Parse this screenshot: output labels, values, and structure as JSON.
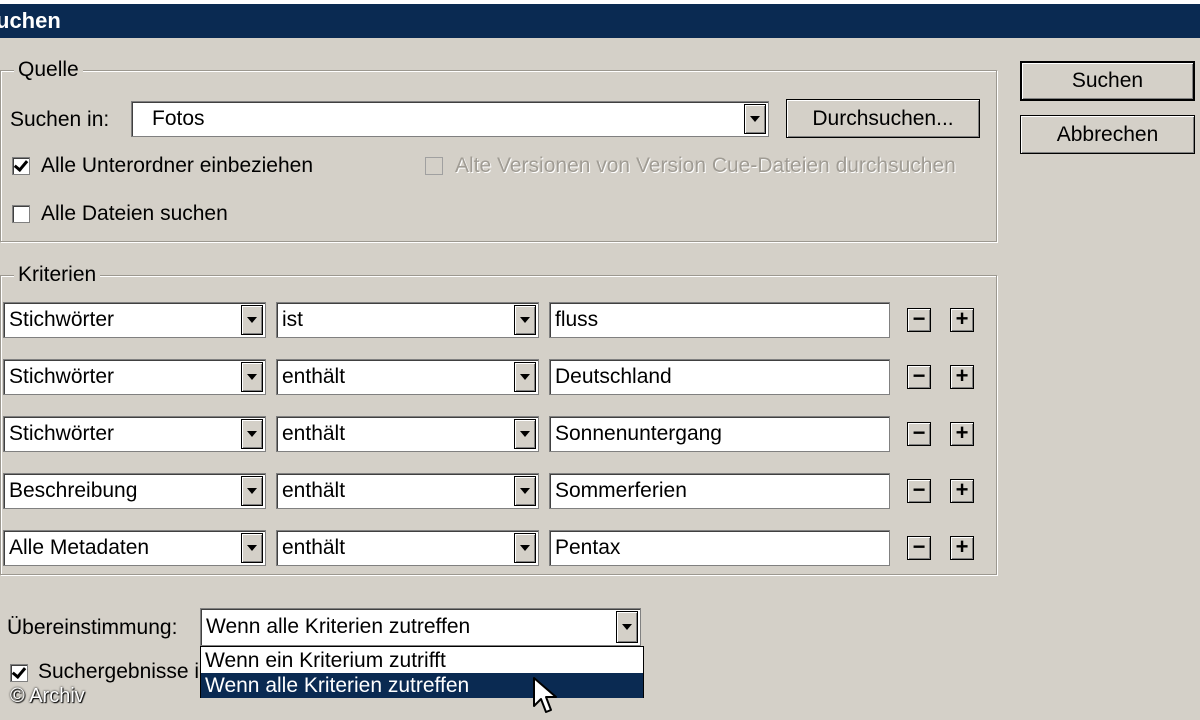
{
  "window": {
    "title": "uchen"
  },
  "buttons": {
    "search": "Suchen",
    "cancel": "Abbrechen",
    "browse": "Durchsuchen..."
  },
  "source": {
    "group_label": "Quelle",
    "search_in_label": "Suchen in:",
    "search_in_value": "Fotos",
    "include_subfolders": {
      "label": "Alle Unterordner einbeziehen",
      "checked": true
    },
    "old_versions": {
      "label": "Alte Versionen von Version Cue-Dateien durchsuchen",
      "checked": false,
      "enabled": false
    },
    "all_files": {
      "label": "Alle Dateien suchen",
      "checked": false
    }
  },
  "criteria": {
    "group_label": "Kriterien",
    "rows": [
      {
        "field": "Stichwörter",
        "operator": "ist",
        "value": "fluss"
      },
      {
        "field": "Stichwörter",
        "operator": "enthält",
        "value": "Deutschland"
      },
      {
        "field": "Stichwörter",
        "operator": "enthält",
        "value": "Sonnenuntergang"
      },
      {
        "field": "Beschreibung",
        "operator": "enthält",
        "value": "Sommerferien"
      },
      {
        "field": "Alle Metadaten",
        "operator": "enthält",
        "value": "Pentax"
      }
    ],
    "minus": "−",
    "plus": "+"
  },
  "match": {
    "label": "Übereinstimmung:",
    "value": "Wenn alle Kriterien zutreffen",
    "options": [
      "Wenn ein Kriterium zutrifft",
      "Wenn alle Kriterien zutreffen"
    ],
    "selected_index": 1
  },
  "results_checkbox": {
    "label": "Suchergebnisse i",
    "checked": true
  },
  "watermark": "© Archiv"
}
